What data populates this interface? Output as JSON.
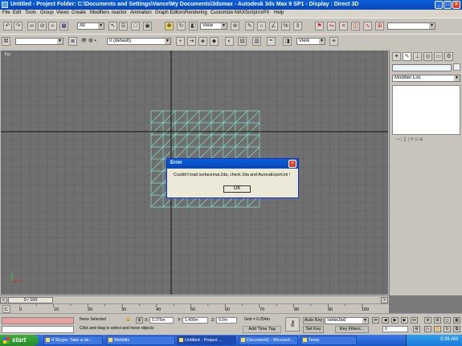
{
  "window": {
    "title": "Untitled      - Project Folder: C:\\Documents and Settings\\Vance\\My Documents\\3dsmax      - Autodesk 3ds Max 9 SP1      - Display : Direct 3D"
  },
  "menu": [
    "File",
    "Edit",
    "Tools",
    "Group",
    "Views",
    "Create",
    "Modifiers",
    "reactor",
    "Animation",
    "Graph Editors",
    "Rendering",
    "Customize",
    "MAXScript",
    "nxPX",
    "Help"
  ],
  "toolbar": {
    "selection_filter": "All",
    "reference_coord": "View",
    "reference_coord2": "View",
    "layer": "0 (default)"
  },
  "viewport": {
    "label": "Top",
    "grid_color": "#606060",
    "mesh_color": "#7de0c8"
  },
  "command_panel": {
    "modifier_list": "Modifier List"
  },
  "dialog": {
    "title": "Error",
    "message": "Couldn't load surfacemat.2da, check 2da and AuroraExport.ini !",
    "ok_label": "OK"
  },
  "timeline": {
    "frame_counter": "0 / 100",
    "ticks": [
      "0",
      "10",
      "20",
      "30",
      "40",
      "50",
      "60",
      "70",
      "80",
      "90",
      "100"
    ]
  },
  "status": {
    "selection": "None Selected",
    "prompt": "Click and drag to select and move objects",
    "x_value": "0.375m",
    "y_value": "1.400m",
    "z_value": "0.0m",
    "x_label": "X:",
    "y_label": "Y:",
    "z_label": "Z:",
    "grid": "Grid = 0.254m",
    "add_time_tag": "Add Time Tag",
    "auto_key": "Auto Key",
    "set_key": "Set Key",
    "key_mode": "Selected",
    "key_filters": "Key Filters...",
    "frame": "0"
  },
  "taskbar": {
    "start": "start",
    "tasks": [
      "4 Skype: Take a de...",
      "Wetbills",
      "Untitled   - Project ...",
      "Document1 - Microsof...",
      "Temp"
    ],
    "clock": "9:36 AM"
  }
}
